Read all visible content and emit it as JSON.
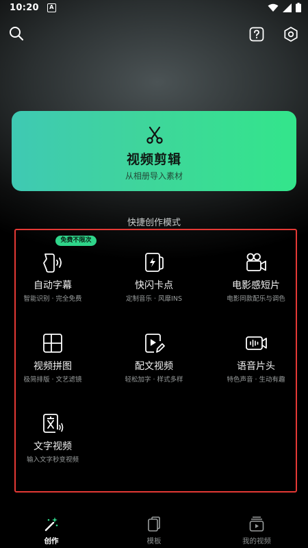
{
  "status_bar": {
    "time": "10:20",
    "notification_icon": "a-app-icon",
    "icons": [
      "wifi-icon",
      "signal-icon",
      "battery-icon"
    ]
  },
  "header": {
    "left_icon": "search-icon",
    "right_icons": [
      "help-icon",
      "settings-icon"
    ]
  },
  "hero": {
    "icon": "scissors-icon",
    "title": "视频剪辑",
    "subtitle": "从相册导入素材"
  },
  "quick_create": {
    "title": "快捷创作模式",
    "badge": "免费不限次",
    "tools": [
      {
        "icon": "auto-subtitle-icon",
        "label": "自动字幕",
        "desc": "智能识别 · 完全免费"
      },
      {
        "icon": "beat-sync-icon",
        "label": "快闪卡点",
        "desc": "定制音乐 · 风靡INS"
      },
      {
        "icon": "movie-camera-icon",
        "label": "电影感短片",
        "desc": "电影同款配乐与调色"
      },
      {
        "icon": "collage-icon",
        "label": "视频拼图",
        "desc": "极简排版 · 文艺滤镜"
      },
      {
        "icon": "video-edit-icon",
        "label": "配文视频",
        "desc": "轻松加字 · 样式多样"
      },
      {
        "icon": "audio-wave-icon",
        "label": "语音片头",
        "desc": "特色声音 · 生动有趣"
      },
      {
        "icon": "text-to-video-icon",
        "label": "文字视频",
        "desc": "输入文字秒变视频"
      }
    ]
  },
  "bottom_nav": {
    "items": [
      {
        "icon": "magic-wand-icon",
        "label": "创作",
        "active": true
      },
      {
        "icon": "template-icon",
        "label": "模板",
        "active": false
      },
      {
        "icon": "my-videos-icon",
        "label": "我的视频",
        "active": false
      }
    ]
  },
  "colors": {
    "accent": "#2fd58a",
    "highlight_border": "#e53935"
  }
}
